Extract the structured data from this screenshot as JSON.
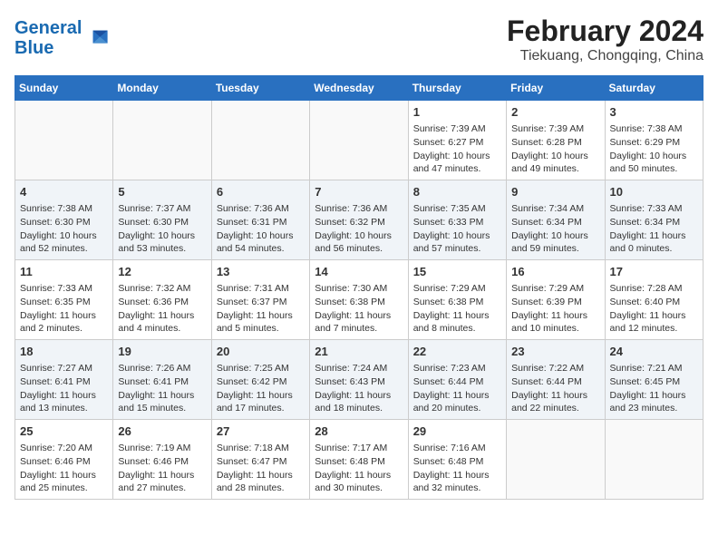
{
  "logo": {
    "line1": "General",
    "line2": "Blue"
  },
  "title": "February 2024",
  "subtitle": "Tiekuang, Chongqing, China",
  "days_of_week": [
    "Sunday",
    "Monday",
    "Tuesday",
    "Wednesday",
    "Thursday",
    "Friday",
    "Saturday"
  ],
  "weeks": [
    [
      {
        "day": "",
        "content": ""
      },
      {
        "day": "",
        "content": ""
      },
      {
        "day": "",
        "content": ""
      },
      {
        "day": "",
        "content": ""
      },
      {
        "day": "1",
        "content": "Sunrise: 7:39 AM\nSunset: 6:27 PM\nDaylight: 10 hours\nand 47 minutes."
      },
      {
        "day": "2",
        "content": "Sunrise: 7:39 AM\nSunset: 6:28 PM\nDaylight: 10 hours\nand 49 minutes."
      },
      {
        "day": "3",
        "content": "Sunrise: 7:38 AM\nSunset: 6:29 PM\nDaylight: 10 hours\nand 50 minutes."
      }
    ],
    [
      {
        "day": "4",
        "content": "Sunrise: 7:38 AM\nSunset: 6:30 PM\nDaylight: 10 hours\nand 52 minutes."
      },
      {
        "day": "5",
        "content": "Sunrise: 7:37 AM\nSunset: 6:30 PM\nDaylight: 10 hours\nand 53 minutes."
      },
      {
        "day": "6",
        "content": "Sunrise: 7:36 AM\nSunset: 6:31 PM\nDaylight: 10 hours\nand 54 minutes."
      },
      {
        "day": "7",
        "content": "Sunrise: 7:36 AM\nSunset: 6:32 PM\nDaylight: 10 hours\nand 56 minutes."
      },
      {
        "day": "8",
        "content": "Sunrise: 7:35 AM\nSunset: 6:33 PM\nDaylight: 10 hours\nand 57 minutes."
      },
      {
        "day": "9",
        "content": "Sunrise: 7:34 AM\nSunset: 6:34 PM\nDaylight: 10 hours\nand 59 minutes."
      },
      {
        "day": "10",
        "content": "Sunrise: 7:33 AM\nSunset: 6:34 PM\nDaylight: 11 hours\nand 0 minutes."
      }
    ],
    [
      {
        "day": "11",
        "content": "Sunrise: 7:33 AM\nSunset: 6:35 PM\nDaylight: 11 hours\nand 2 minutes."
      },
      {
        "day": "12",
        "content": "Sunrise: 7:32 AM\nSunset: 6:36 PM\nDaylight: 11 hours\nand 4 minutes."
      },
      {
        "day": "13",
        "content": "Sunrise: 7:31 AM\nSunset: 6:37 PM\nDaylight: 11 hours\nand 5 minutes."
      },
      {
        "day": "14",
        "content": "Sunrise: 7:30 AM\nSunset: 6:38 PM\nDaylight: 11 hours\nand 7 minutes."
      },
      {
        "day": "15",
        "content": "Sunrise: 7:29 AM\nSunset: 6:38 PM\nDaylight: 11 hours\nand 8 minutes."
      },
      {
        "day": "16",
        "content": "Sunrise: 7:29 AM\nSunset: 6:39 PM\nDaylight: 11 hours\nand 10 minutes."
      },
      {
        "day": "17",
        "content": "Sunrise: 7:28 AM\nSunset: 6:40 PM\nDaylight: 11 hours\nand 12 minutes."
      }
    ],
    [
      {
        "day": "18",
        "content": "Sunrise: 7:27 AM\nSunset: 6:41 PM\nDaylight: 11 hours\nand 13 minutes."
      },
      {
        "day": "19",
        "content": "Sunrise: 7:26 AM\nSunset: 6:41 PM\nDaylight: 11 hours\nand 15 minutes."
      },
      {
        "day": "20",
        "content": "Sunrise: 7:25 AM\nSunset: 6:42 PM\nDaylight: 11 hours\nand 17 minutes."
      },
      {
        "day": "21",
        "content": "Sunrise: 7:24 AM\nSunset: 6:43 PM\nDaylight: 11 hours\nand 18 minutes."
      },
      {
        "day": "22",
        "content": "Sunrise: 7:23 AM\nSunset: 6:44 PM\nDaylight: 11 hours\nand 20 minutes."
      },
      {
        "day": "23",
        "content": "Sunrise: 7:22 AM\nSunset: 6:44 PM\nDaylight: 11 hours\nand 22 minutes."
      },
      {
        "day": "24",
        "content": "Sunrise: 7:21 AM\nSunset: 6:45 PM\nDaylight: 11 hours\nand 23 minutes."
      }
    ],
    [
      {
        "day": "25",
        "content": "Sunrise: 7:20 AM\nSunset: 6:46 PM\nDaylight: 11 hours\nand 25 minutes."
      },
      {
        "day": "26",
        "content": "Sunrise: 7:19 AM\nSunset: 6:46 PM\nDaylight: 11 hours\nand 27 minutes."
      },
      {
        "day": "27",
        "content": "Sunrise: 7:18 AM\nSunset: 6:47 PM\nDaylight: 11 hours\nand 28 minutes."
      },
      {
        "day": "28",
        "content": "Sunrise: 7:17 AM\nSunset: 6:48 PM\nDaylight: 11 hours\nand 30 minutes."
      },
      {
        "day": "29",
        "content": "Sunrise: 7:16 AM\nSunset: 6:48 PM\nDaylight: 11 hours\nand 32 minutes."
      },
      {
        "day": "",
        "content": ""
      },
      {
        "day": "",
        "content": ""
      }
    ]
  ]
}
